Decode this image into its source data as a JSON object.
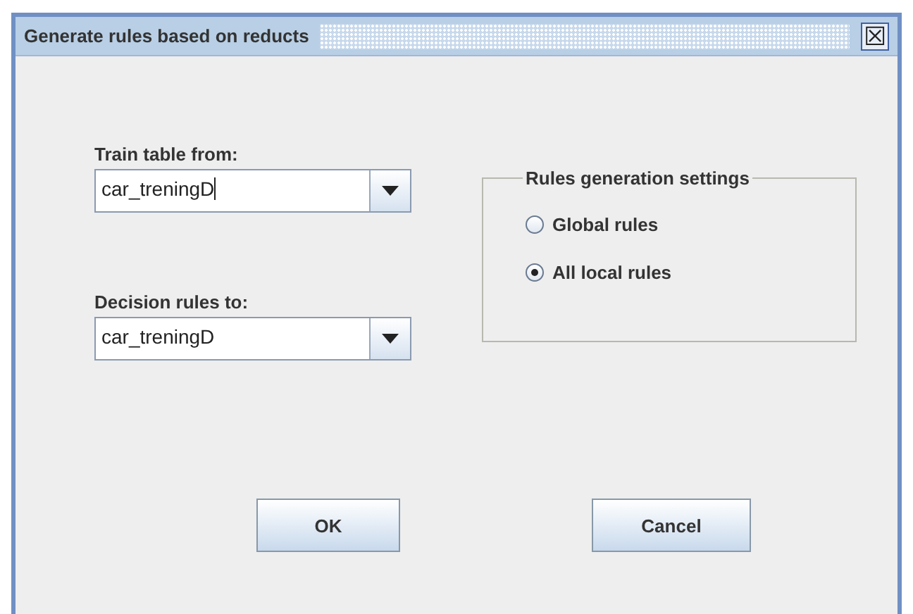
{
  "window": {
    "title": "Generate rules based on reducts",
    "close_glyph": "☒"
  },
  "fields": [
    {
      "label": "Train table from:",
      "value": "car_treningD",
      "focused": true
    },
    {
      "label": "Decision rules to:",
      "value": "car_treningD",
      "focused": false
    }
  ],
  "settings": {
    "title": "Rules generation settings",
    "options": [
      {
        "label": "Global rules",
        "selected": false
      },
      {
        "label": "All local rules",
        "selected": true
      }
    ]
  },
  "buttons": [
    "OK",
    "Cancel"
  ]
}
